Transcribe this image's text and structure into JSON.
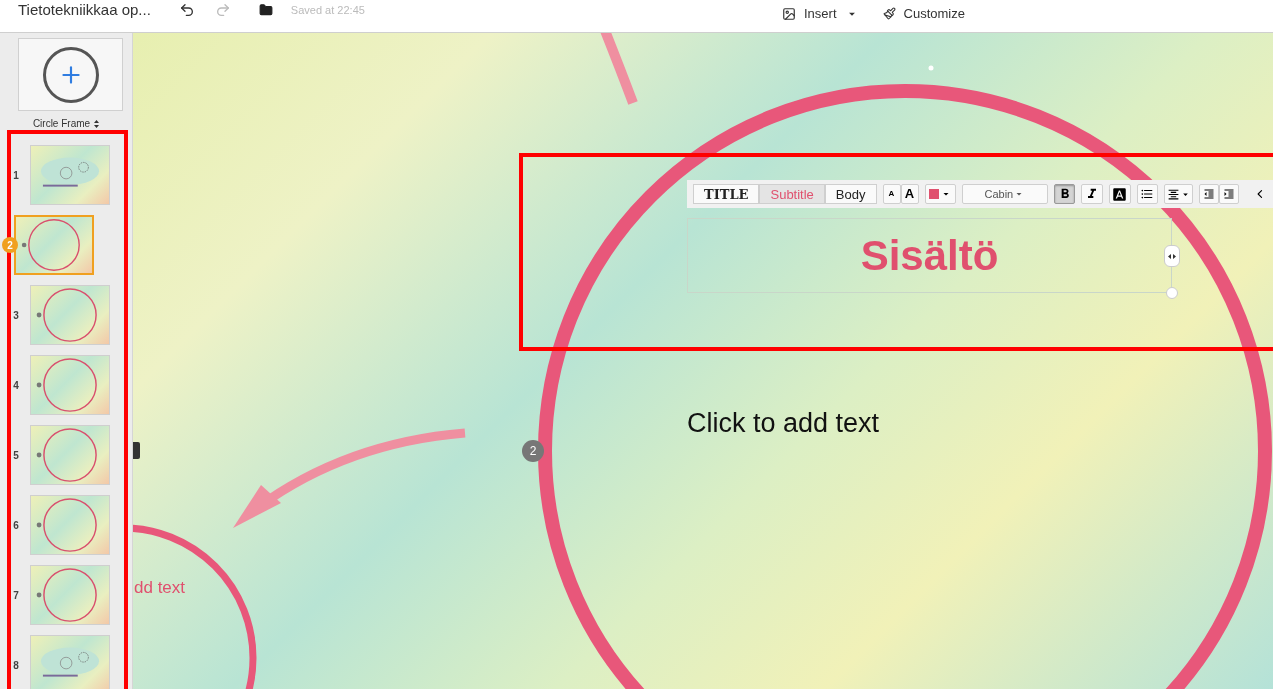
{
  "header": {
    "title": "Tietotekniikkaa op...",
    "status": "Saved at 22:45",
    "menu": [
      {
        "label": "Insert",
        "kind": "insert"
      },
      {
        "label": "Customize",
        "kind": "customize"
      }
    ]
  },
  "sidebar": {
    "add_label": "Circle Frame",
    "slides": [
      {
        "number": "1",
        "selected": false,
        "kind": "overview"
      },
      {
        "number": "2",
        "selected": true,
        "kind": "circle"
      },
      {
        "number": "3",
        "selected": false,
        "kind": "circle"
      },
      {
        "number": "4",
        "selected": false,
        "kind": "circle"
      },
      {
        "number": "5",
        "selected": false,
        "kind": "circle"
      },
      {
        "number": "6",
        "selected": false,
        "kind": "circle"
      },
      {
        "number": "7",
        "selected": false,
        "kind": "circle"
      },
      {
        "number": "8",
        "selected": false,
        "kind": "overview"
      }
    ]
  },
  "canvas": {
    "text_toolbar": {
      "styles": [
        {
          "label": "TITLE",
          "selected": false
        },
        {
          "label": "Subtitle",
          "selected": true
        },
        {
          "label": "Body",
          "selected": false
        }
      ],
      "size_buttons": [
        "A",
        "A"
      ],
      "color": "#e0506e",
      "font": "Cabin",
      "bold": true,
      "italic": false
    },
    "title": "Sisältö",
    "body_placeholder": "Click to add text",
    "frame_number": "2",
    "partial_text": "dd text"
  }
}
